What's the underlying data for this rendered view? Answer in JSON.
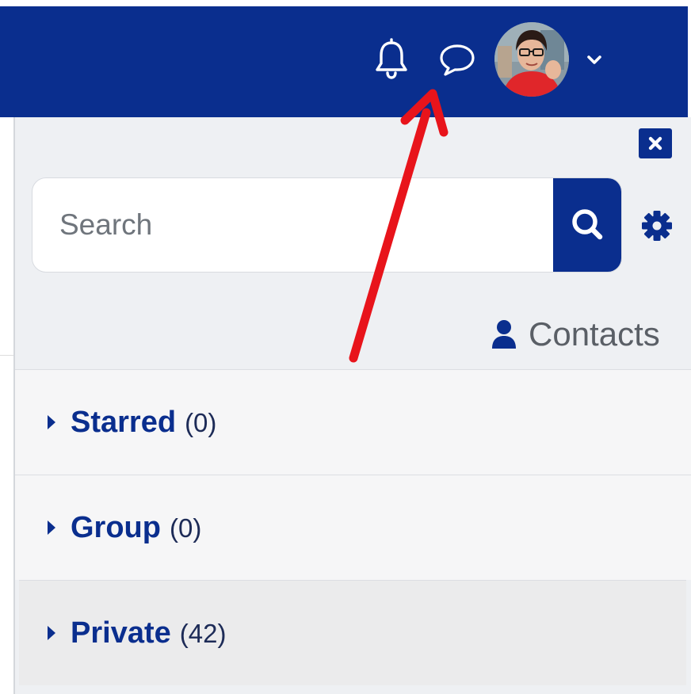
{
  "navbar": {
    "background": "#0a2e8e",
    "icons": [
      "bell-icon",
      "chat-bubble-icon",
      "chevron-down-icon"
    ]
  },
  "drawer": {
    "search": {
      "placeholder": "Search",
      "value": ""
    },
    "contacts": {
      "label": "Contacts"
    },
    "groups": [
      {
        "name": "Starred",
        "count": "(0)"
      },
      {
        "name": "Group",
        "count": "(0)"
      },
      {
        "name": "Private",
        "count": "(42)"
      }
    ]
  },
  "annotation": {
    "type": "arrow",
    "color": "#e8141b"
  }
}
